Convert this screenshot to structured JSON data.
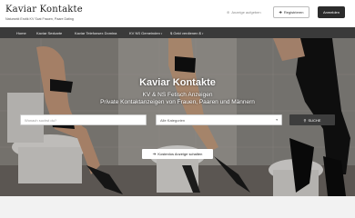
{
  "header": {
    "title": "Kaviar Kontakte",
    "subtitle": "Natursekt Erotik KV Scat Frauen, Paare Dating",
    "post_ad_label": "Anzeige aufgeben",
    "post_ad_icon": "plus-icon",
    "register_label": "Registrieren",
    "register_icon": "user-plus-icon",
    "login_label": "Anmelden"
  },
  "nav": {
    "items": [
      {
        "label": "Home"
      },
      {
        "label": "Kaviar Sexkarte"
      },
      {
        "label": "Kaviar Telefonsex Domina"
      },
      {
        "label": "KV NS Gemeinden",
        "has_caret": true
      },
      {
        "label": "$ Geld verdienen $",
        "has_caret": true
      }
    ]
  },
  "hero": {
    "title": "Kaviar Kontakte",
    "subtitle_1": "KV & NS Fetisch Anzeigen",
    "subtitle_2": "Private Kontaktanzeigen von Frauen, Paaren und Männern",
    "search_placeholder": "Wonach suchst du?",
    "category_value": "Alle Kategorien",
    "search_button": "SUCHE",
    "free_button": "Kostenlos Anzeige schalten",
    "free_button_icon": "arrow-right-icon"
  },
  "colors": {
    "nav_bg": "#3a3a3a",
    "login_bg": "#2b2b2b",
    "search_btn_bg": "#3d3d3d"
  }
}
